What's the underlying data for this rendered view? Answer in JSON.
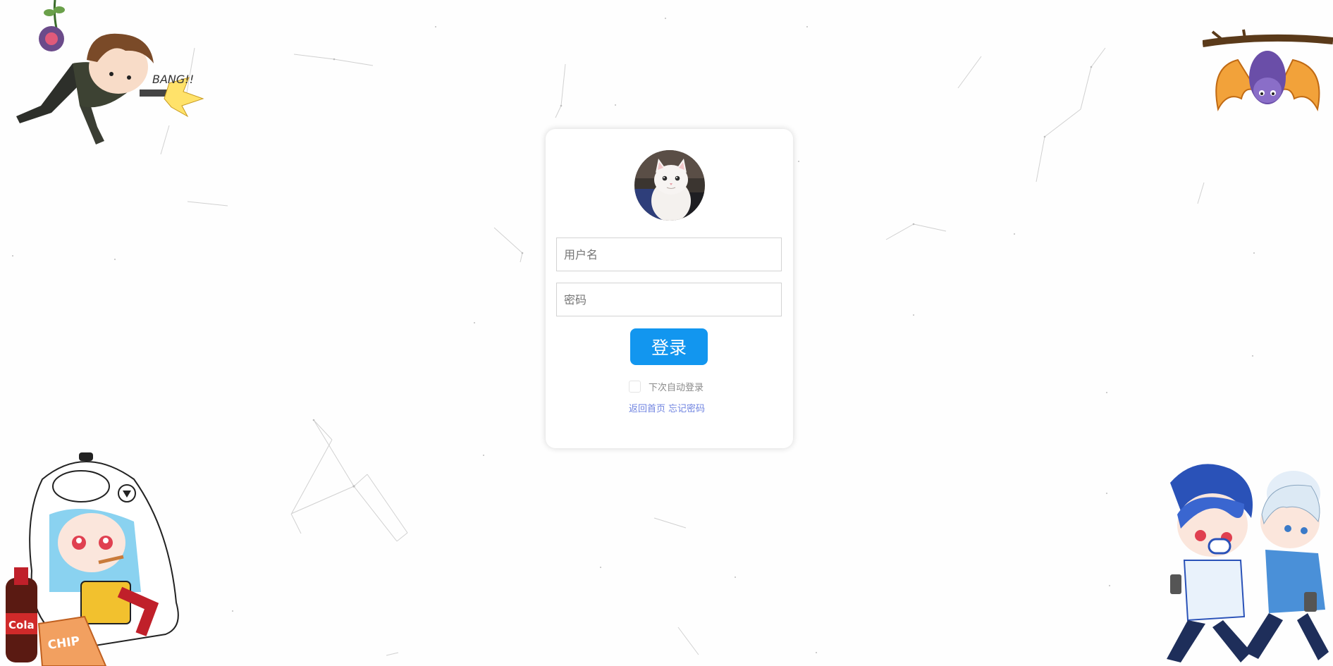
{
  "login": {
    "username_placeholder": "用户名",
    "password_placeholder": "密码",
    "submit_label": "登录",
    "remember_label": "下次自动登录",
    "back_home_link": "返回首页",
    "forgot_password_link": "忘记密码"
  },
  "decorations": {
    "top_left_sfx": "BANG!!",
    "bottom_left_bottle": "Cola",
    "bottom_left_bag": "CHIP"
  },
  "colors": {
    "accent": "#1296ef",
    "link": "#6f83e0",
    "card_bg": "#ffffff",
    "page_bg": "#fefefe"
  }
}
